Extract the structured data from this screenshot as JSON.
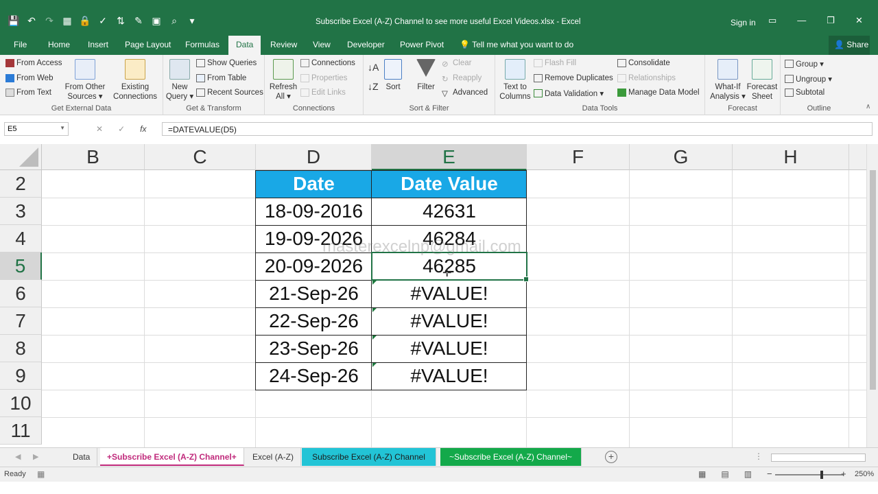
{
  "window": {
    "title": "Subscribe Excel (A-Z) Channel to see more useful Excel Videos.xlsx - Excel",
    "sign_in": "Sign in",
    "minimize": "—",
    "restore": "❐",
    "close": "✕"
  },
  "qat": [
    "save-icon",
    "undo-icon",
    "redo-icon",
    "table-icon",
    "lock-icon"
  ],
  "tabs": [
    "File",
    "Home",
    "Insert",
    "Page Layout",
    "Formulas",
    "Data",
    "Review",
    "View",
    "Developer",
    "Power Pivot"
  ],
  "active_tab": "Data",
  "tell_me": "Tell me what you want to do",
  "share": "Share",
  "ribbon": {
    "get_external": {
      "items": [
        "From Access",
        "From Web",
        "From Text"
      ],
      "from_other": "From Other\nSources ▾",
      "existing": "Existing\nConnections",
      "label": "Get External Data"
    },
    "get_transform": {
      "new_query": "New\nQuery ▾",
      "items": [
        "Show Queries",
        "From Table",
        "Recent Sources"
      ],
      "label": "Get & Transform"
    },
    "connections": {
      "refresh": "Refresh\nAll ▾",
      "items": [
        "Connections",
        "Properties",
        "Edit Links"
      ],
      "label": "Connections"
    },
    "sort_filter": {
      "sort": "Sort",
      "filter": "Filter",
      "items": [
        "Clear",
        "Reapply",
        "Advanced"
      ],
      "label": "Sort & Filter"
    },
    "data_tools": {
      "text_to_columns": "Text to\nColumns",
      "items": [
        "Flash Fill",
        "Remove Duplicates",
        "Data Validation ▾"
      ],
      "items2": [
        "Consolidate",
        "Relationships",
        "Manage Data Model"
      ],
      "label": "Data Tools"
    },
    "forecast": {
      "what_if": "What-If\nAnalysis ▾",
      "sheet": "Forecast\nSheet",
      "label": "Forecast"
    },
    "outline": {
      "items": [
        "Group ▾",
        "Ungroup ▾",
        "Subtotal"
      ],
      "label": "Outline"
    }
  },
  "formula_bar": {
    "name_box": "E5",
    "cancel": "✕",
    "enter": "✓",
    "fx": "fx",
    "formula": "=DATEVALUE(D5)"
  },
  "grid": {
    "columns": [
      "B",
      "C",
      "D",
      "E",
      "F",
      "G",
      "H"
    ],
    "rows": [
      "2",
      "3",
      "4",
      "5",
      "6",
      "7",
      "8",
      "9",
      "10",
      "11"
    ],
    "header": {
      "date": "Date",
      "value": "Date Value"
    },
    "data": [
      {
        "date": "18-09-2016",
        "value": "42631"
      },
      {
        "date": "19-09-2026",
        "value": "46284"
      },
      {
        "date": "20-09-2026",
        "value": "46285"
      },
      {
        "date": "21-Sep-26",
        "value": "#VALUE!"
      },
      {
        "date": "22-Sep-26",
        "value": "#VALUE!"
      },
      {
        "date": "23-Sep-26",
        "value": "#VALUE!"
      },
      {
        "date": "24-Sep-26",
        "value": "#VALUE!"
      }
    ],
    "watermark": "masterexcelnp@gmail.com",
    "selected_cell": "E5"
  },
  "sheets": [
    {
      "name": "Data",
      "color": "#f0f0f0",
      "text": "#333333"
    },
    {
      "name": "+Subscribe Excel (A-Z) Channel+",
      "color": "#ffffff",
      "text": "#c0297b"
    },
    {
      "name": "Excel (A-Z)",
      "color": "#f0f0f0",
      "text": "#333333"
    },
    {
      "name": "Subscribe Excel (A-Z) Channel",
      "color": "#22c4d6",
      "text": "#1b1b1b"
    },
    {
      "name": "~Subscribe Excel (A-Z) Channel~",
      "color": "#13a94a",
      "text": "#ffffff"
    }
  ],
  "status": {
    "ready": "Ready",
    "zoom": "250%",
    "minus": "−",
    "plus": "+"
  },
  "colors": {
    "excel_green": "#217346",
    "header_fill": "#19a8e6"
  }
}
